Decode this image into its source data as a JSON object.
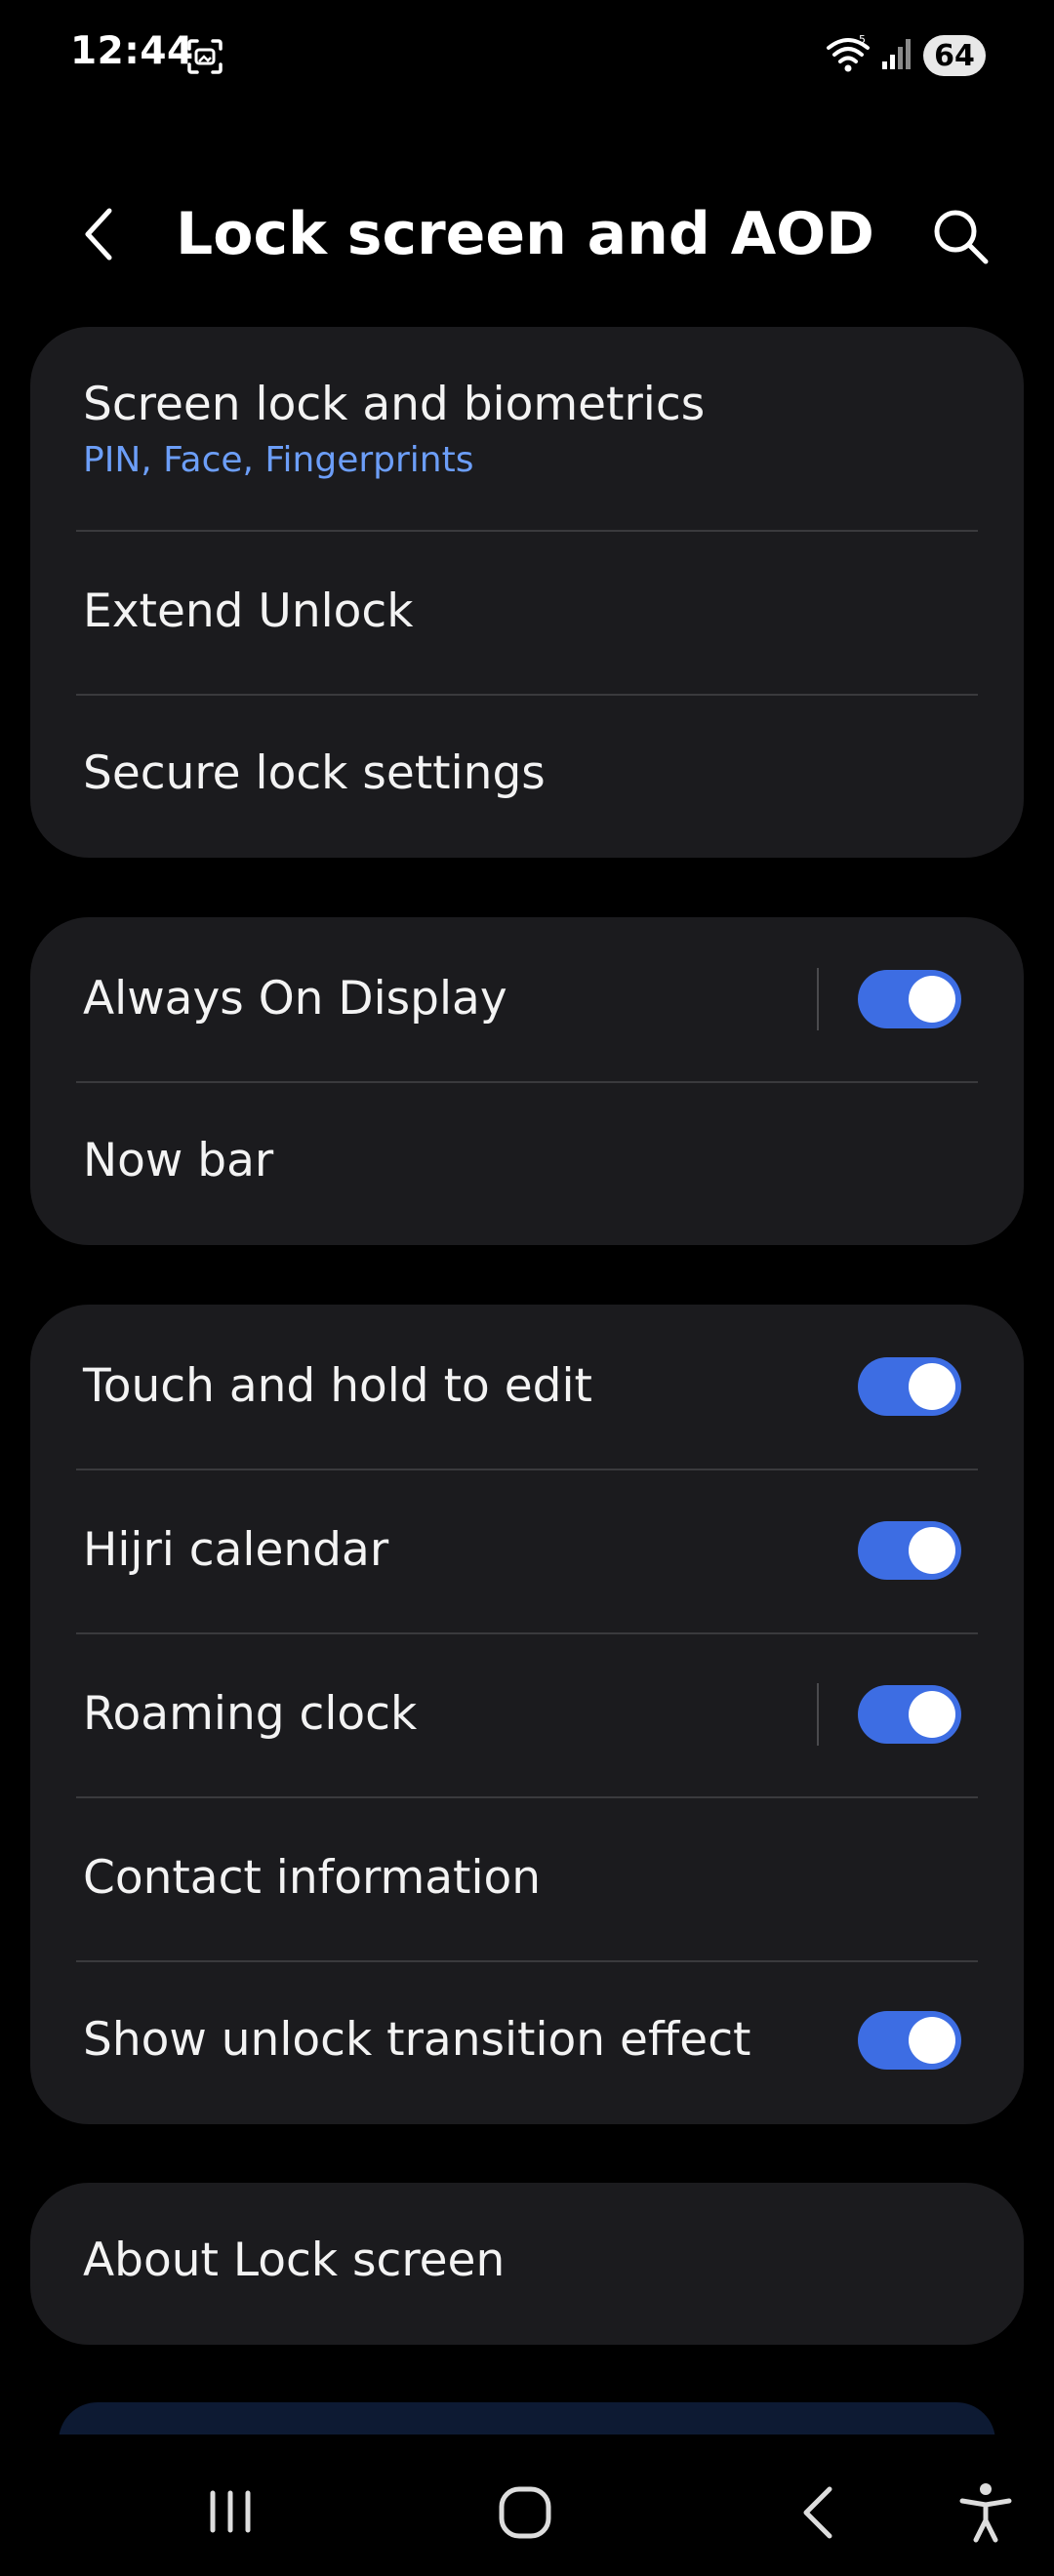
{
  "status_bar": {
    "time": "12:44",
    "battery": "64",
    "network_label": "5"
  },
  "header": {
    "title": "Lock screen and AOD"
  },
  "groups": [
    {
      "items": [
        {
          "title": "Screen lock and biometrics",
          "subtitle": "PIN, Face, Fingerprints"
        },
        {
          "title": "Extend Unlock"
        },
        {
          "title": "Secure lock settings"
        }
      ]
    },
    {
      "items": [
        {
          "title": "Always On Display",
          "toggle": true
        },
        {
          "title": "Now bar"
        }
      ]
    },
    {
      "items": [
        {
          "title": "Touch and hold to edit",
          "toggle": true
        },
        {
          "title": "Hijri calendar",
          "toggle": true
        },
        {
          "title": "Roaming clock",
          "toggle": true
        },
        {
          "title": "Contact information"
        },
        {
          "title": "Show unlock transition effect",
          "toggle": true
        }
      ]
    },
    {
      "items": [
        {
          "title": "About Lock screen"
        }
      ]
    }
  ],
  "colors": {
    "background": "#000000",
    "card": "#1b1b1e",
    "accent": "#3d6de3",
    "subtitle": "#6c9ef8",
    "divider": "#3a3a3d"
  },
  "icons": {
    "back": "chevron-left-icon",
    "search": "search-icon",
    "nav_recents": "recent-apps-icon",
    "nav_home": "home-icon",
    "nav_back": "back-icon",
    "nav_accessibility": "accessibility-icon"
  }
}
